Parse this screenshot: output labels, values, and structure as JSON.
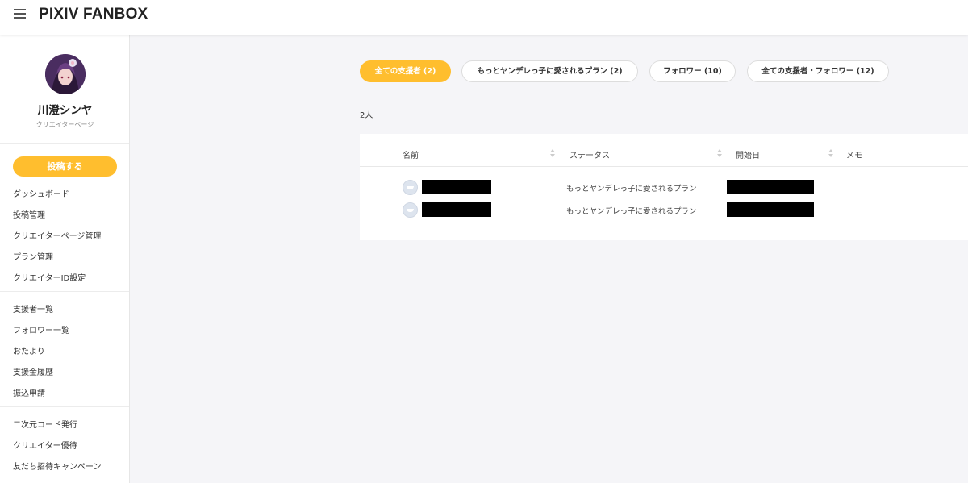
{
  "header": {
    "menu_icon": "hamburger-menu-icon",
    "logo": "PIXIV FANBOX"
  },
  "sidebar": {
    "creator_name": "川澄シンヤ",
    "creator_sub": "クリエイターページ",
    "post_button": "投稿する",
    "group1": [
      "ダッシュボード",
      "投稿管理",
      "クリエイターページ管理",
      "プラン管理",
      "クリエイターID設定"
    ],
    "group2": [
      "支援者一覧",
      "フォロワー一覧",
      "おたより",
      "支援金履歴",
      "振込申請"
    ],
    "group3": [
      "二次元コード発行",
      "クリエイター優待",
      "友だち招待キャンペーン"
    ]
  },
  "tabs": [
    {
      "label": "全ての支援者 (2)",
      "active": true
    },
    {
      "label": "もっとヤンデレっ子に愛されるプラン (2)",
      "active": false
    },
    {
      "label": "フォロワー (10)",
      "active": false
    },
    {
      "label": "全ての支援者・フォロワー (12)",
      "active": false
    }
  ],
  "count": "2人",
  "table": {
    "headers": [
      "名前",
      "ステータス",
      "開始日",
      "メモ"
    ],
    "rows": [
      {
        "status": "もっとヤンデレっ子に愛されるプラン"
      },
      {
        "status": "もっとヤンデレっ子に愛されるプラン"
      }
    ]
  },
  "colors": {
    "accent": "#ffbe2e",
    "background": "#f5f5f8"
  }
}
